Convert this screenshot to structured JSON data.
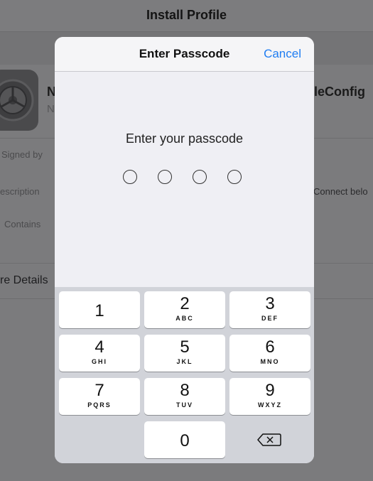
{
  "background": {
    "nav_title": "Install Profile",
    "profile_name_left": "N",
    "profile_name_right": "leConfig",
    "profile_sub_left": "N",
    "rows": [
      {
        "label": "Signed by",
        "value": ""
      },
      {
        "label": "escription",
        "value": "Connect belo"
      },
      {
        "label": "Contains",
        "value": ""
      }
    ],
    "more_details": "re Details"
  },
  "modal": {
    "title": "Enter Passcode",
    "cancel_label": "Cancel",
    "prompt": "Enter your passcode",
    "passcode_length": 4
  },
  "keypad": {
    "keys": [
      {
        "digit": "1",
        "letters": ""
      },
      {
        "digit": "2",
        "letters": "ABC"
      },
      {
        "digit": "3",
        "letters": "DEF"
      },
      {
        "digit": "4",
        "letters": "GHI"
      },
      {
        "digit": "5",
        "letters": "JKL"
      },
      {
        "digit": "6",
        "letters": "MNO"
      },
      {
        "digit": "7",
        "letters": "PQRS"
      },
      {
        "digit": "8",
        "letters": "TUV"
      },
      {
        "digit": "9",
        "letters": "WXYZ"
      },
      {
        "digit": "0",
        "letters": ""
      }
    ],
    "delete_icon": "delete-backspace-icon"
  },
  "colors": {
    "accent": "#1f7df2",
    "keypad_bg": "#d1d3d9",
    "dim_overlay": "#7b7b7d"
  }
}
